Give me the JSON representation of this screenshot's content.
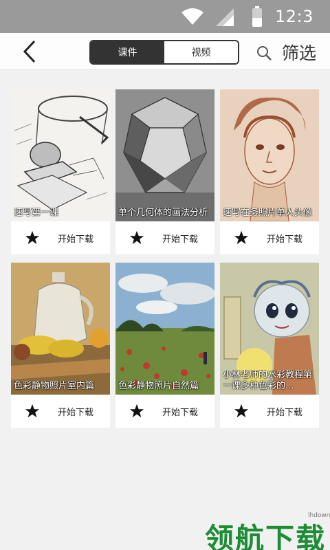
{
  "status_bar": {
    "time": "12:3"
  },
  "header": {
    "tabs": [
      {
        "label": "课件",
        "active": true
      },
      {
        "label": "视频",
        "active": false
      }
    ],
    "filter_label": "筛选"
  },
  "courses": [
    {
      "title": "速写第一课",
      "action": "开始下载"
    },
    {
      "title": "单个几何体的画法分析",
      "action": "开始下载"
    },
    {
      "title": "速写在务照片单人头像",
      "action": "开始下载"
    },
    {
      "title": "色彩静物照片室内篇",
      "action": "开始下载"
    },
    {
      "title": "色彩静物照片自然篇",
      "action": "开始下载"
    },
    {
      "title": "小林老师的水彩教程第一课多种色彩的...",
      "action": "开始下载"
    }
  ],
  "watermark": {
    "url": "lhdown.com",
    "text": "领航下载"
  },
  "colors": {
    "status_bar": "#9a9a9a",
    "active_tab": "#333333",
    "watermark": "#1c8c35"
  }
}
